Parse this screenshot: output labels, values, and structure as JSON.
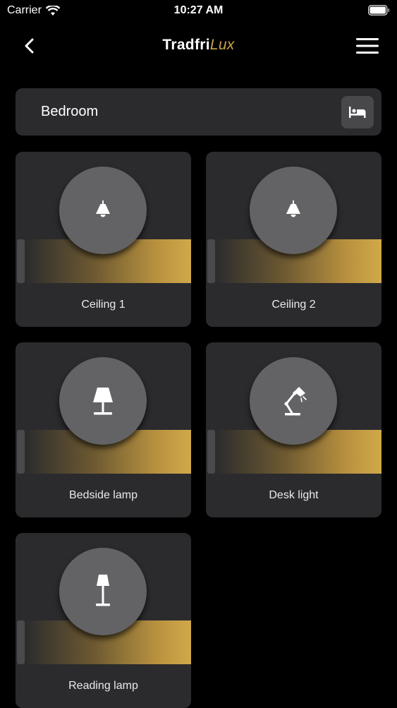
{
  "status_bar": {
    "carrier": "Carrier",
    "time": "10:27 AM"
  },
  "nav": {
    "title_main": "Tradfri",
    "title_accent": "Lux",
    "accent_color": "#c9a24a"
  },
  "room": {
    "name": "Bedroom",
    "icon": "bed-icon"
  },
  "lights": [
    {
      "label": "Ceiling 1",
      "icon": "ceiling-lamp-icon"
    },
    {
      "label": "Ceiling 2",
      "icon": "ceiling-lamp-icon"
    },
    {
      "label": "Bedside lamp",
      "icon": "table-lamp-icon"
    },
    {
      "label": "Desk light",
      "icon": "desk-lamp-icon"
    },
    {
      "label": "Reading lamp",
      "icon": "floor-lamp-icon"
    }
  ]
}
